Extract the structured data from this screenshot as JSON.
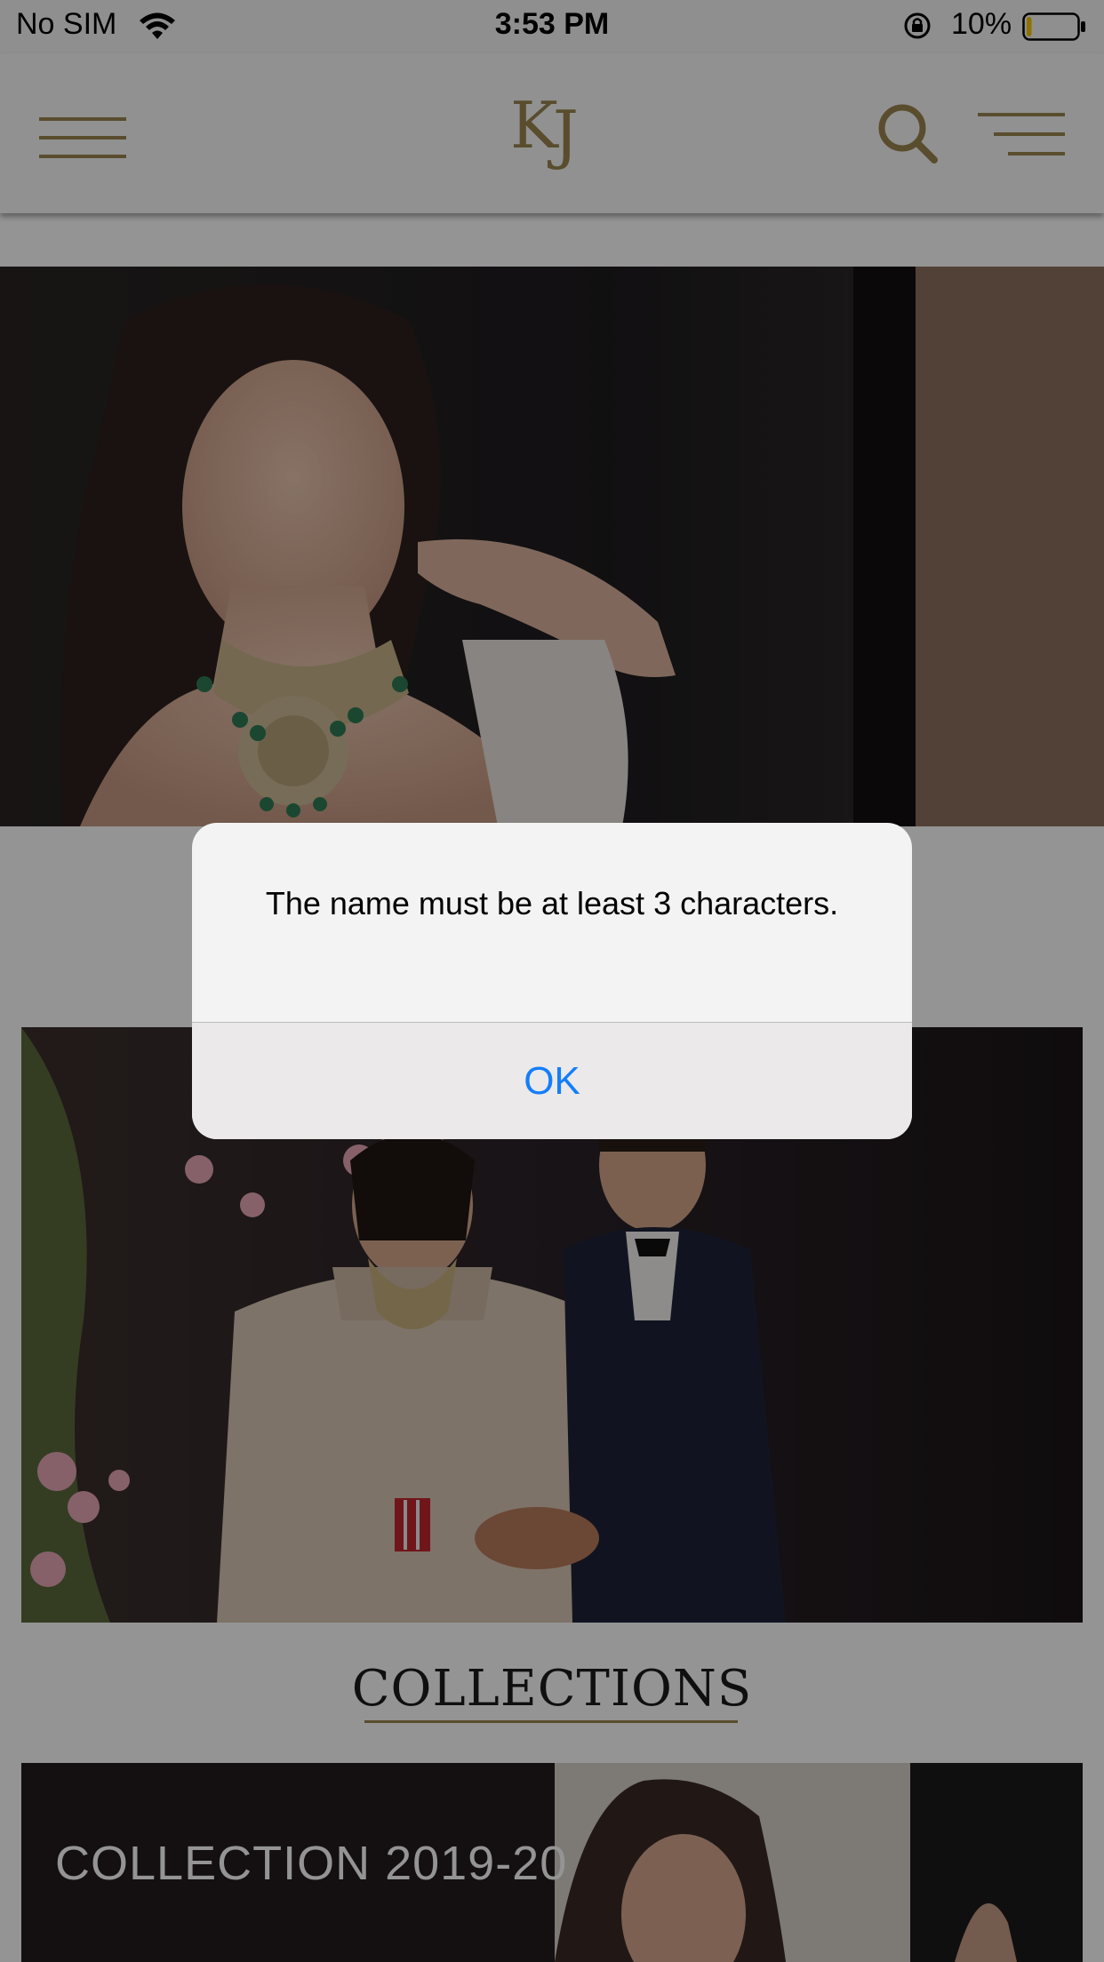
{
  "status_bar": {
    "carrier": "No SIM",
    "time": "3:53 PM",
    "battery_percent": "10%",
    "battery_level": 0.1,
    "icons": [
      "wifi-icon",
      "orientation-lock-icon",
      "battery-icon"
    ]
  },
  "nav": {
    "logo_text": "KJ",
    "accent_color": "#9a8650",
    "icons": [
      "hamburger-menu-icon",
      "search-icon",
      "filter-menu-icon"
    ]
  },
  "content": {
    "collections_heading": "COLLECTIONS",
    "collection_card_label": "COLLECTION 2019-20"
  },
  "alert": {
    "message": "The name must be at least 3 characters.",
    "ok_label": "OK",
    "button_color": "#147efb"
  }
}
